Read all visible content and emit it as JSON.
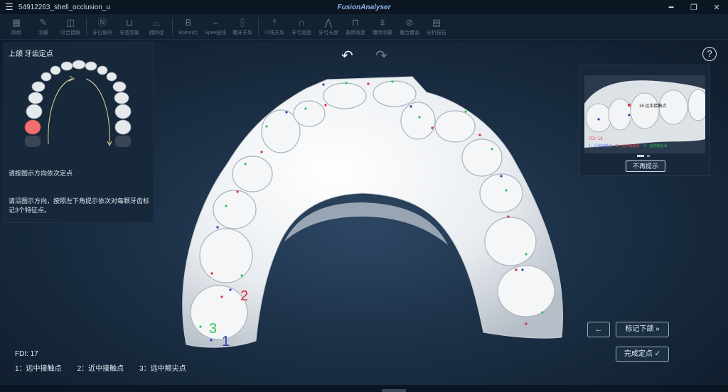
{
  "app": {
    "filename": "54912263_shell_occlusion_u",
    "brand": "FusionAnalyser"
  },
  "toolbar": [
    {
      "icon": "grid-icon",
      "glyph": "▦",
      "label": "网格"
    },
    {
      "icon": "pencil-icon",
      "glyph": "✎",
      "label": "测量"
    },
    {
      "icon": "bite-icon",
      "glyph": "◫",
      "label": "咬合接触"
    },
    {
      "icon": "tooth-number-icon",
      "glyph": "Ⓝ",
      "label": "牙位编号"
    },
    {
      "icon": "tooth-width-icon",
      "glyph": "⊔",
      "label": "牙宽测量"
    },
    {
      "icon": "crowding-icon",
      "glyph": "⌓",
      "label": "拥挤度"
    },
    {
      "icon": "bolton-icon",
      "glyph": "B",
      "label": "Bolton比"
    },
    {
      "icon": "spee-icon",
      "glyph": "⌣",
      "label": "Spee曲线"
    },
    {
      "icon": "overbite-icon",
      "glyph": "⩉",
      "label": "覆牙关系"
    },
    {
      "icon": "midline-icon",
      "glyph": "⫯",
      "label": "中线关系"
    },
    {
      "icon": "arch-width-icon",
      "glyph": "∩",
      "label": "牙弓宽度"
    },
    {
      "icon": "arch-length-icon",
      "glyph": "⋀",
      "label": "牙弓长度"
    },
    {
      "icon": "basal-bone-icon",
      "glyph": "⊓",
      "label": "基骨宽度"
    },
    {
      "icon": "root-icon",
      "glyph": "⩨",
      "label": "覆骨测量"
    },
    {
      "icon": "overlay-icon",
      "glyph": "⊘",
      "label": "叠合覆盖"
    },
    {
      "icon": "report-icon",
      "glyph": "▤",
      "label": "分析报告"
    }
  ],
  "left_panel": {
    "title": "上颌 牙齿定点",
    "instruction1": "请按图示方向依次定点",
    "instruction2": "请沿图示方向，按照左下角提示依次对每颗牙齿标记3个特征点。"
  },
  "preview": {
    "label": "16 远中接触点",
    "fdi": "FDI: 16",
    "legend": [
      "1：近中接触点",
      "2：远中接触点",
      "3：远中颊尖点"
    ],
    "dismiss_label": "不再提示"
  },
  "buttons": {
    "prev": "←",
    "next": "标记下颌 »",
    "finish": "完成定点 ✓"
  },
  "status": {
    "fdi": "FDI: 17",
    "legend": [
      "1：远中接触点",
      "2：近中接触点",
      "3：远中颊尖点"
    ]
  },
  "markers": {
    "one": "1",
    "two": "2",
    "three": "3"
  },
  "colors": {
    "point1": "#2a3ea8",
    "point2": "#d92a3a",
    "point3": "#2ec45a",
    "accent": "#f07070"
  }
}
